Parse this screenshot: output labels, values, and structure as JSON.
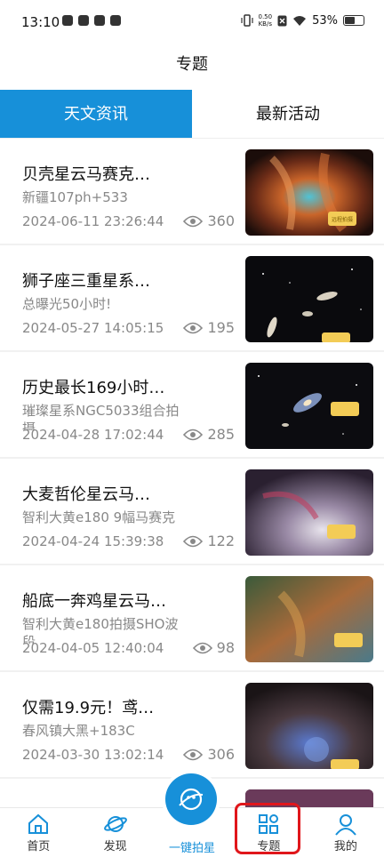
{
  "status_bar": {
    "time": "13:10",
    "net_speed_value": "0.50",
    "net_speed_unit": "KB/s",
    "battery": "53%"
  },
  "header": {
    "title": "专题"
  },
  "tabs": [
    {
      "label": "天文资讯",
      "active": true
    },
    {
      "label": "最新活动",
      "active": false
    }
  ],
  "articles": [
    {
      "title": "贝壳星云马赛克…",
      "subtitle": "新疆107ph+533",
      "date": "2024-06-11 23:26:44",
      "views": "360"
    },
    {
      "title": "狮子座三重星系…",
      "subtitle": "总曝光50小时!",
      "date": "2024-05-27 14:05:15",
      "views": "195"
    },
    {
      "title": "历史最长169小时…",
      "subtitle": "璀璨星系NGC5033组合拍摄",
      "date": "2024-04-28 17:02:44",
      "views": "285"
    },
    {
      "title": "大麦哲伦星云马…",
      "subtitle": "智利大黄e180 9幅马赛克",
      "date": "2024-04-24 15:39:38",
      "views": "122"
    },
    {
      "title": "船底一奔鸡星云马…",
      "subtitle": "智利大黄e180拍摄SHO波段",
      "date": "2024-04-05 12:40:04",
      "views": "98"
    },
    {
      "title": "仅需19.9元！鸢…",
      "subtitle": "春风镇大黑+183C",
      "date": "2024-03-30 13:02:14",
      "views": "306"
    }
  ],
  "thumb_tag": "远程拍摄",
  "bottom_nav": [
    {
      "label": "首页",
      "icon": "home-icon"
    },
    {
      "label": "发现",
      "icon": "planet-icon"
    },
    {
      "label": "一键拍星",
      "icon": "camera-planet-icon"
    },
    {
      "label": "专题",
      "icon": "grid-icon"
    },
    {
      "label": "我的",
      "icon": "user-icon"
    }
  ],
  "colors": {
    "accent": "#1790d9",
    "highlight": "#e0161b"
  }
}
